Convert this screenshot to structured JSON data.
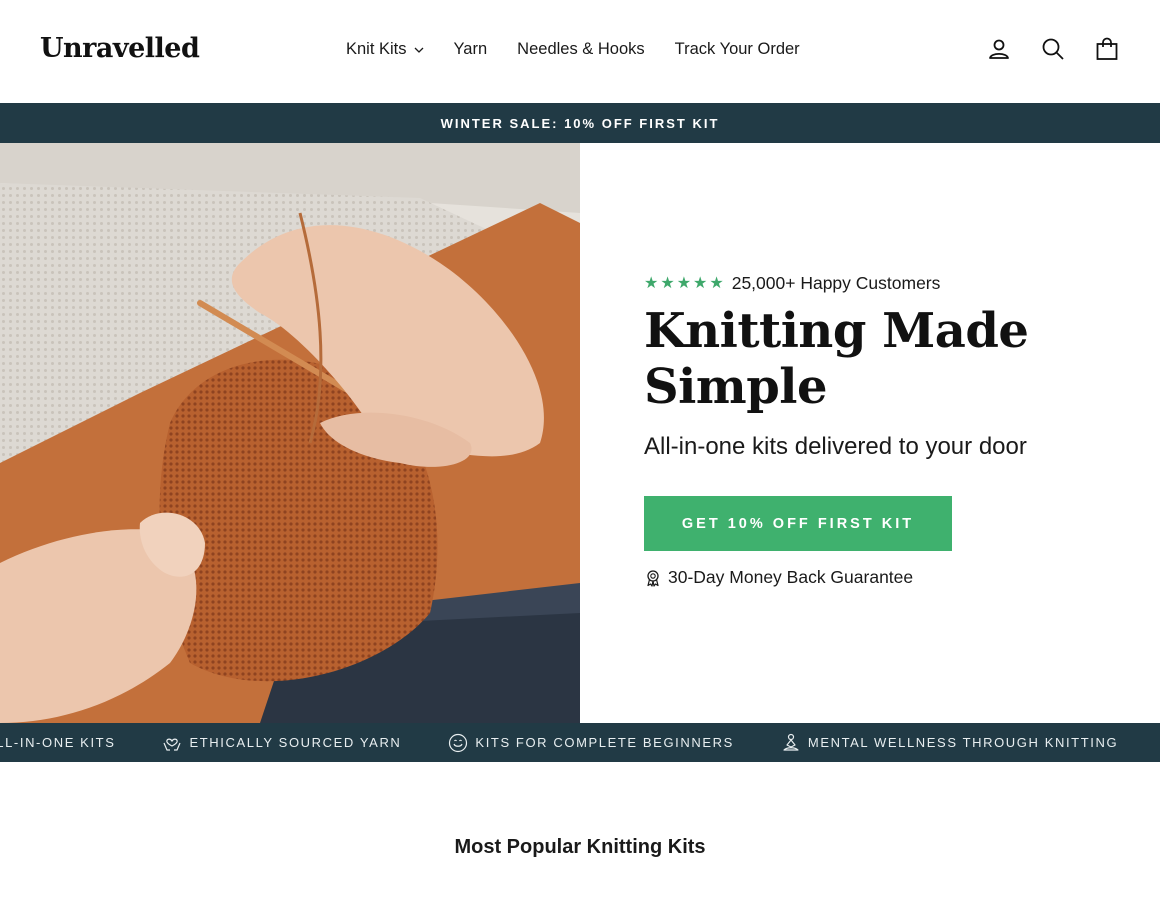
{
  "header": {
    "logo": "Unravelled",
    "nav": [
      {
        "label": "Knit Kits",
        "has_dropdown": true
      },
      {
        "label": "Yarn"
      },
      {
        "label": "Needles & Hooks"
      },
      {
        "label": "Track Your Order"
      }
    ],
    "icons": [
      "account-icon",
      "search-icon",
      "cart-icon"
    ]
  },
  "promo_bar": {
    "text": "WINTER SALE: 10% OFF FIRST KIT",
    "bg": "#213a45"
  },
  "hero": {
    "rating": {
      "stars": 5,
      "text": "25,000+ Happy Customers",
      "star_color": "#3ea86b"
    },
    "headline": "Knitting Made Simple",
    "subheadline": "All-in-one kits delivered to your door",
    "cta_label": "GET 10% OFF FIRST KIT",
    "cta_color": "#3fb16e",
    "guarantee": "30-Day Money Back Guarantee",
    "image_alt_icon": "hands-knitting-photo"
  },
  "features": [
    {
      "icon": "box-icon",
      "label": "ALL-IN-ONE KITS"
    },
    {
      "icon": "heart-hands-icon",
      "label": "ETHICALLY SOURCED YARN"
    },
    {
      "icon": "smile-icon",
      "label": "KITS FOR COMPLETE BEGINNERS"
    },
    {
      "icon": "meditation-icon",
      "label": "MENTAL WELLNESS THROUGH KNITTING"
    }
  ],
  "section": {
    "title": "Most Popular Knitting Kits"
  }
}
